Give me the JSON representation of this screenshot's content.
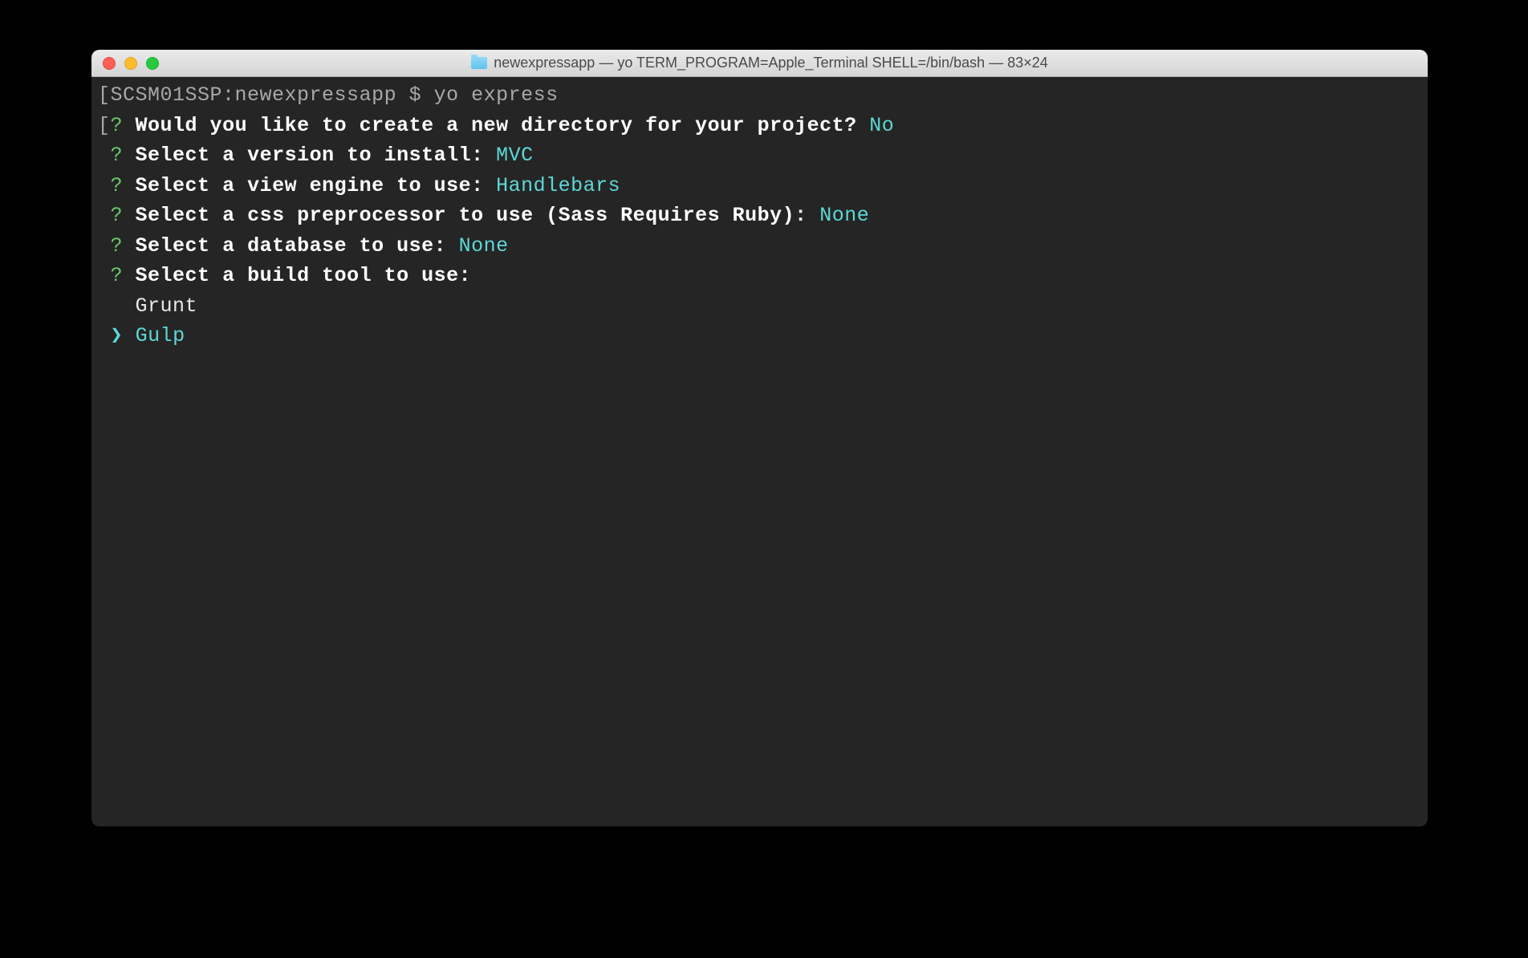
{
  "titlebar": {
    "title": "newexpressapp — yo TERM_PROGRAM=Apple_Terminal SHELL=/bin/bash — 83×24"
  },
  "terminal": {
    "prompt_host": "SCSM01SSP:newexpressapp",
    "prompt_symbol": "$",
    "command": "yo express",
    "questions": [
      {
        "marker": "?",
        "text": "Would you like to create a new directory for your project?",
        "answer": "No"
      },
      {
        "marker": "?",
        "text": "Select a version to install:",
        "answer": "MVC"
      },
      {
        "marker": "?",
        "text": "Select a view engine to use:",
        "answer": "Handlebars"
      },
      {
        "marker": "?",
        "text": "Select a css preprocessor to use (Sass Requires Ruby):",
        "answer": "None"
      },
      {
        "marker": "?",
        "text": "Select a database to use:",
        "answer": "None"
      },
      {
        "marker": "?",
        "text": "Select a build tool to use:",
        "answer": ""
      }
    ],
    "options": [
      {
        "label": "Grunt",
        "selected": false
      },
      {
        "label": "Gulp",
        "selected": true
      }
    ],
    "selection_caret": "❯",
    "bracket_open": "[",
    "bracket_close": "]"
  }
}
